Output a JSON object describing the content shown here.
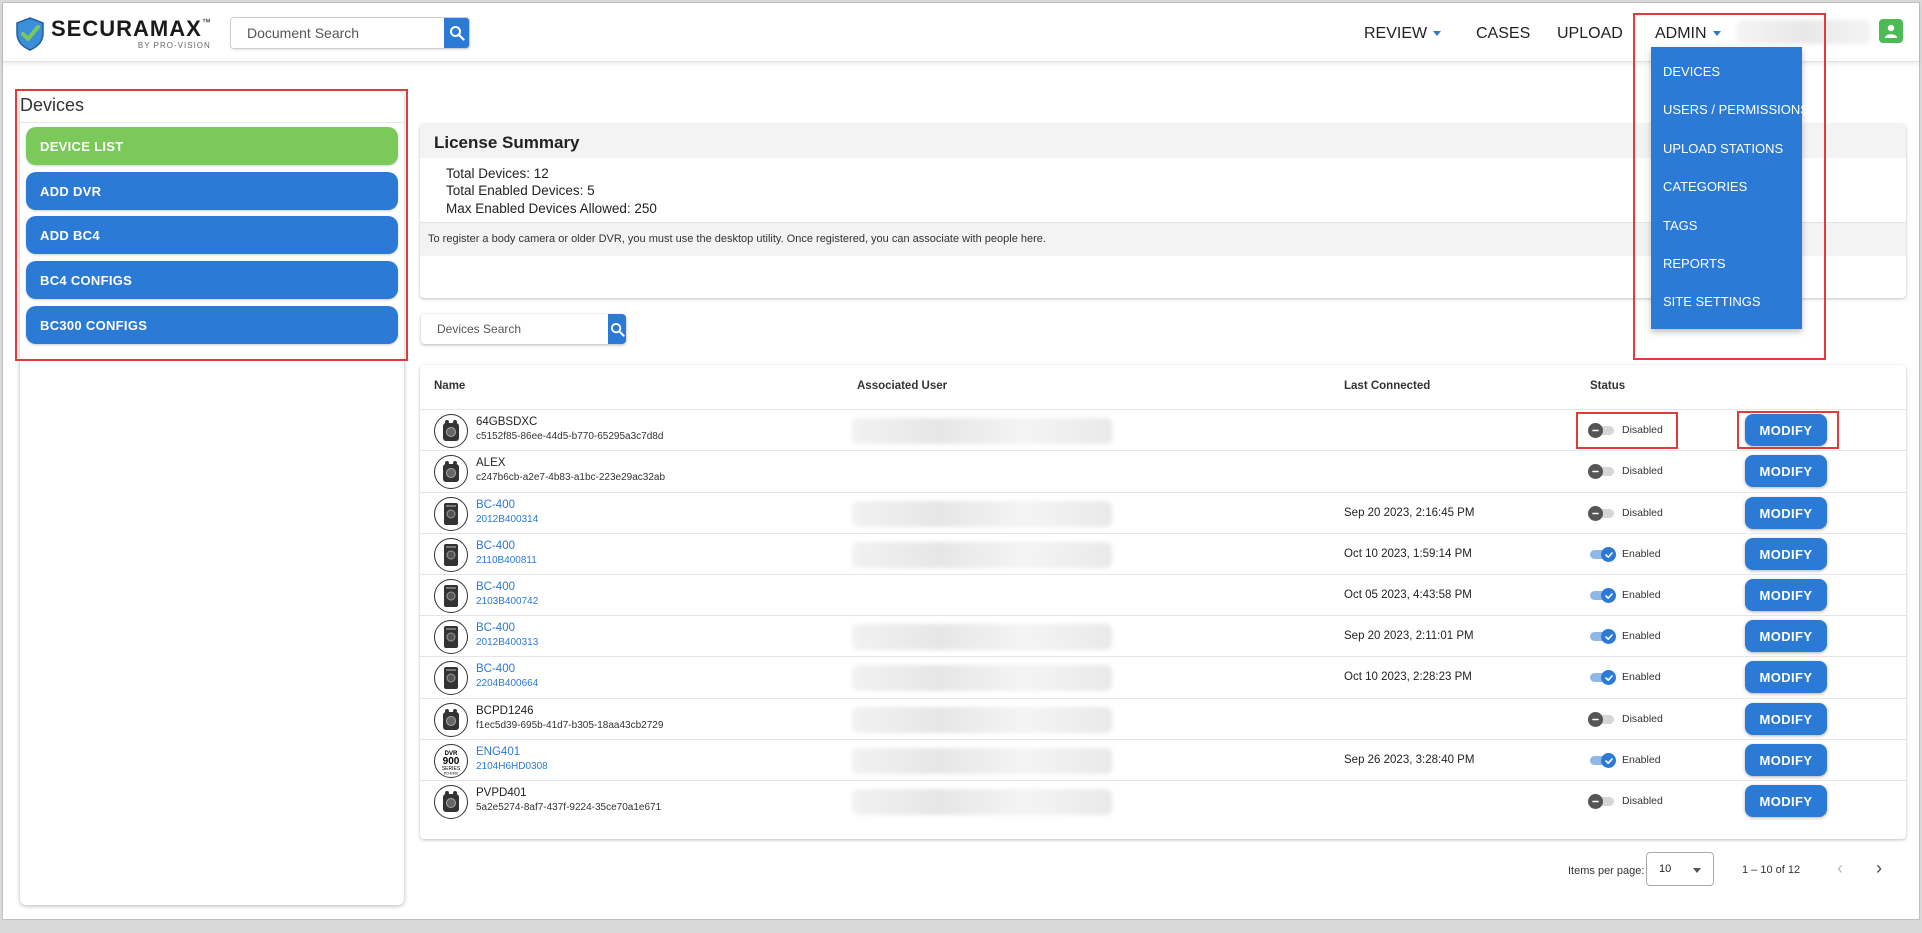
{
  "header": {
    "logo_text": "SECURAMAX",
    "logo_tm": "™",
    "logo_sub": "BY PRO-VISION",
    "doc_search_placeholder": "Document Search",
    "nav": {
      "review": "REVIEW",
      "cases": "CASES",
      "upload": "UPLOAD",
      "admin": "ADMIN"
    }
  },
  "admin_menu": [
    "DEVICES",
    "USERS / PERMISSIONS",
    "UPLOAD STATIONS",
    "CATEGORIES",
    "TAGS",
    "REPORTS",
    "SITE SETTINGS"
  ],
  "sidebar": {
    "title": "Devices",
    "items": [
      {
        "label": "DEVICE LIST",
        "active": true
      },
      {
        "label": "ADD DVR",
        "active": false
      },
      {
        "label": "ADD BC4",
        "active": false
      },
      {
        "label": "BC4 CONFIGS",
        "active": false
      },
      {
        "label": "BC300 CONFIGS",
        "active": false
      }
    ]
  },
  "license": {
    "title": "License Summary",
    "total_devices": "Total Devices: 12",
    "total_enabled": "Total Enabled Devices: 5",
    "max_enabled": "Max Enabled Devices Allowed: 250",
    "note": "To register a body camera or older DVR, you must use the desktop utility. Once registered, you can associate with people here."
  },
  "devices_search_placeholder": "Devices Search",
  "table": {
    "headers": {
      "name": "Name",
      "associated_user": "Associated User",
      "last_connected": "Last Connected",
      "status": "Status"
    },
    "modify_label": "MODIFY",
    "rows": [
      {
        "name": "64GBSDXC",
        "id": "c5152f85-86ee-44d5-b770-65295a3c7d8d",
        "link": false,
        "last": "",
        "status": "Disabled",
        "enabled": false,
        "icon": "bodycam-icon",
        "assoc": true
      },
      {
        "name": "ALEX",
        "id": "c247b6cb-a2e7-4b83-a1bc-223e29ac32ab",
        "link": false,
        "last": "",
        "status": "Disabled",
        "enabled": false,
        "icon": "bodycam-icon",
        "assoc": false
      },
      {
        "name": "BC-400",
        "id": "2012B400314",
        "link": true,
        "last": "Sep 20 2023, 2:16:45 PM",
        "status": "Disabled",
        "enabled": false,
        "icon": "bodycam-bc400-icon",
        "assoc": true
      },
      {
        "name": "BC-400",
        "id": "2110B400811",
        "link": true,
        "last": "Oct 10 2023, 1:59:14 PM",
        "status": "Enabled",
        "enabled": true,
        "icon": "bodycam-bc400-icon",
        "assoc": true
      },
      {
        "name": "BC-400",
        "id": "2103B400742",
        "link": true,
        "last": "Oct 05 2023, 4:43:58 PM",
        "status": "Enabled",
        "enabled": true,
        "icon": "bodycam-bc400-icon",
        "assoc": false
      },
      {
        "name": "BC-400",
        "id": "2012B400313",
        "link": true,
        "last": "Sep 20 2023, 2:11:01 PM",
        "status": "Enabled",
        "enabled": true,
        "icon": "bodycam-bc400-icon",
        "assoc": true
      },
      {
        "name": "BC-400",
        "id": "2204B400664",
        "link": true,
        "last": "Oct 10 2023, 2:28:23 PM",
        "status": "Enabled",
        "enabled": true,
        "icon": "bodycam-bc400-icon",
        "assoc": true
      },
      {
        "name": "BCPD1246",
        "id": "f1ec5d39-695b-41d7-b305-18aa43cb2729",
        "link": false,
        "last": "",
        "status": "Disabled",
        "enabled": false,
        "icon": "bodycam-icon",
        "assoc": true
      },
      {
        "name": "ENG401",
        "id": "2104H6HD0308",
        "link": true,
        "last": "Sep 26 2023, 3:28:40 PM",
        "status": "Enabled",
        "enabled": true,
        "icon": "dvr-900-icon",
        "assoc": true
      },
      {
        "name": "PVPD401",
        "id": "5a2e5274-8af7-437f-9224-35ce70a1e671",
        "link": false,
        "last": "",
        "status": "Disabled",
        "enabled": false,
        "icon": "bodycam-icon",
        "assoc": true
      }
    ]
  },
  "dvr_badge": {
    "top": "DVR",
    "num": "900",
    "bottom": "SERIES",
    "tiny": "PD-E900"
  },
  "pagination": {
    "items_per_page_label": "Items per page:",
    "items_per_page_value": "10",
    "range": "1 – 10 of 12"
  },
  "colors": {
    "primary": "#2a7ad6",
    "active_green": "#7ac95a",
    "highlight_red": "#e03a3a",
    "user_green": "#4cbb55"
  }
}
